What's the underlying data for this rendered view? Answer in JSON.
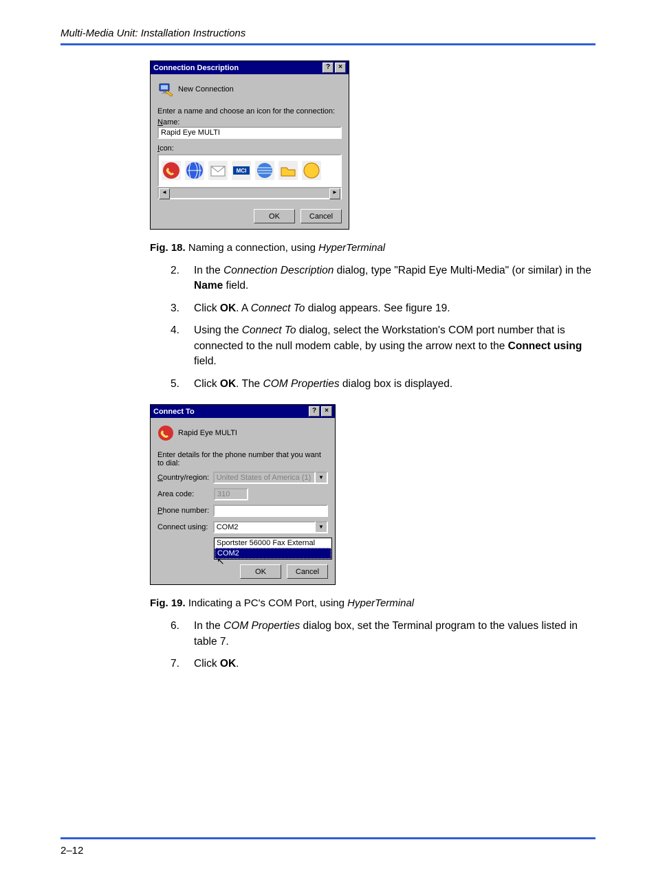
{
  "header": "Multi-Media Unit: Installation Instructions",
  "page_number": "2–12",
  "dlg1": {
    "title": "Connection Description",
    "help_glyph": "?",
    "close_glyph": "×",
    "new_conn_label": "New Connection",
    "prompt": "Enter a name and choose an icon for the connection:",
    "name_label": "Name:",
    "name_value": "Rapid Eye MULTI",
    "icon_label": "Icon:",
    "scroll_left": "◄",
    "scroll_right": "►",
    "ok": "OK",
    "cancel": "Cancel"
  },
  "fig18_prefix": "Fig. 18.",
  "fig18_text_a": "Naming  a connection, using ",
  "fig18_text_i": "HyperTerminal",
  "steps_a": [
    {
      "n": "2.",
      "pre": "In the ",
      "i": "Connection Description",
      "post": " dialog, type \"Rapid Eye Multi-Media\" (or similar) in the ",
      "b": "Name",
      "after": " field."
    },
    {
      "n": "3.",
      "pre": "Click ",
      "b": "OK",
      "post": ". A ",
      "i": "Connect To",
      "after": " dialog appears. See figure 19."
    },
    {
      "n": "4.",
      "pre": "Using the ",
      "i": "Connect To",
      "post": " dialog, select the Workstation's COM port number that is connected to the null modem cable, by using the arrow next to the ",
      "b": "Connect using",
      "after": " field."
    },
    {
      "n": "5.",
      "pre": "Click ",
      "b": "OK",
      "post": ". The ",
      "i": "COM Properties",
      "after": " dialog box is displayed."
    }
  ],
  "dlg2": {
    "title": "Connect To",
    "help_glyph": "?",
    "close_glyph": "×",
    "conn_name": "Rapid Eye MULTI",
    "prompt": "Enter details for the phone number that you want to dial:",
    "country_label": "Country/region:",
    "country_value": "United States of America (1)",
    "area_label": "Area code:",
    "area_value": "310",
    "phone_label": "Phone number:",
    "phone_value": "",
    "using_label": "Connect using:",
    "using_value": "COM2",
    "dropdown_opts": [
      "Sportster 56000 Fax External",
      "COM2"
    ],
    "drop_glyph": "▼",
    "ok": "OK",
    "cancel": "Cancel"
  },
  "fig19_prefix": "Fig. 19.",
  "fig19_text_a": "Indicating a PC's COM Port, using ",
  "fig19_text_i": "HyperTerminal",
  "steps_b": [
    {
      "n": "6.",
      "pre": "In the ",
      "i": "COM Properties",
      "post": " dialog box, set the Terminal program to the values listed in table 7."
    },
    {
      "n": "7.",
      "pre": "Click ",
      "b": "OK",
      "post": "."
    }
  ]
}
